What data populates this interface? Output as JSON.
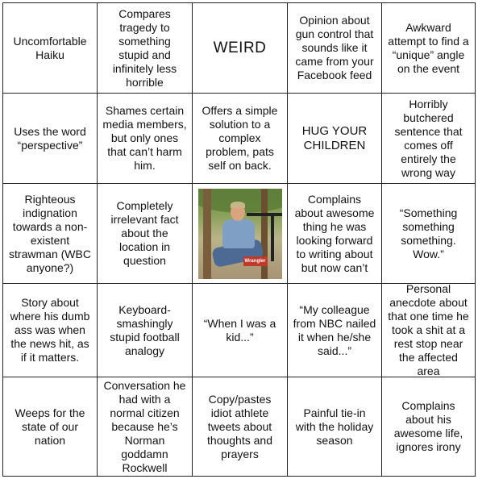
{
  "board": {
    "rows": [
      [
        "Uncomfortable Haiku",
        "Compares tragedy to something stupid and infinitely less horrible",
        "WEIRD",
        "Opinion about gun control that sounds like it came from your Facebook feed",
        "Awkward attempt to find a “unique” angle on the event"
      ],
      [
        "Uses the word “perspective”",
        "Shames certain media members, but only ones that can’t harm him.",
        "Offers a simple solution to a complex problem, pats self on back.",
        "HUG YOUR CHILDREN",
        "Horribly butchered sentence that comes off entirely the wrong way"
      ],
      [
        "Righteous indignation towards a non-existent strawman (WBC anyone?)",
        "Completely irrelevant fact about the location in question",
        "",
        "Complains about awesome thing he was looking forward to writing about but now can’t",
        "“Something something something. Wow.”"
      ],
      [
        "Story about where his dumb ass was when the news hit, as if it matters.",
        "Keyboard-smashingly stupid football analogy",
        "“When I was a kid...”",
        "“My colleague from NBC nailed it when he/she said...”",
        "Personal anecdote about that one time he took a shit at a rest stop near the affected area"
      ],
      [
        "Weeps for the state of our nation",
        "Conversation he had with a normal citizen because he’s Norman goddamn Rockwell",
        "Copy/pastes idiot athlete tweets about thoughts and prayers",
        "Painful tie-in with the holiday season",
        "Complains about his awesome life, ignores irony"
      ]
    ],
    "photo_logo": "Wrangler"
  }
}
